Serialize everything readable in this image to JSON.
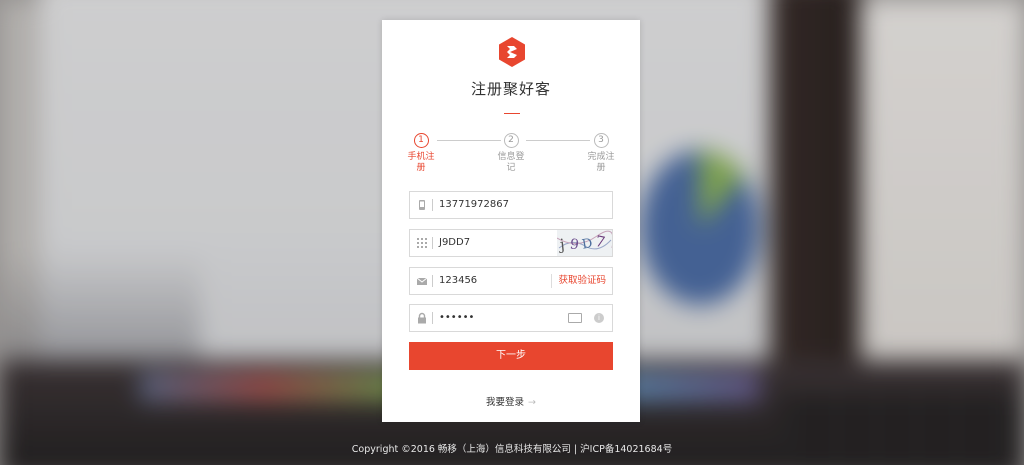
{
  "brand": {
    "accent": "#e8462f",
    "logo": "juhaoke-hexagon-logo"
  },
  "title": "注册聚好客",
  "steps": [
    {
      "number": "1",
      "label": "手机注册",
      "active": true
    },
    {
      "number": "2",
      "label": "信息登记",
      "active": false
    },
    {
      "number": "3",
      "label": "完成注册",
      "active": false
    }
  ],
  "fields": {
    "phone": {
      "icon": "phone-icon",
      "value": "13771972867"
    },
    "captcha": {
      "icon": "grid-icon",
      "value": "J9DD7",
      "image_text": "j9D7"
    },
    "sms": {
      "icon": "mail-icon",
      "value": "123456",
      "button": "获取验证码"
    },
    "password": {
      "icon": "lock-icon",
      "value": "••••••"
    }
  },
  "submit_label": "下一步",
  "login_link": "我要登录",
  "footer": "Copyright ©2016 畅移（上海）信息科技有限公司 | 沪ICP备14021684号"
}
